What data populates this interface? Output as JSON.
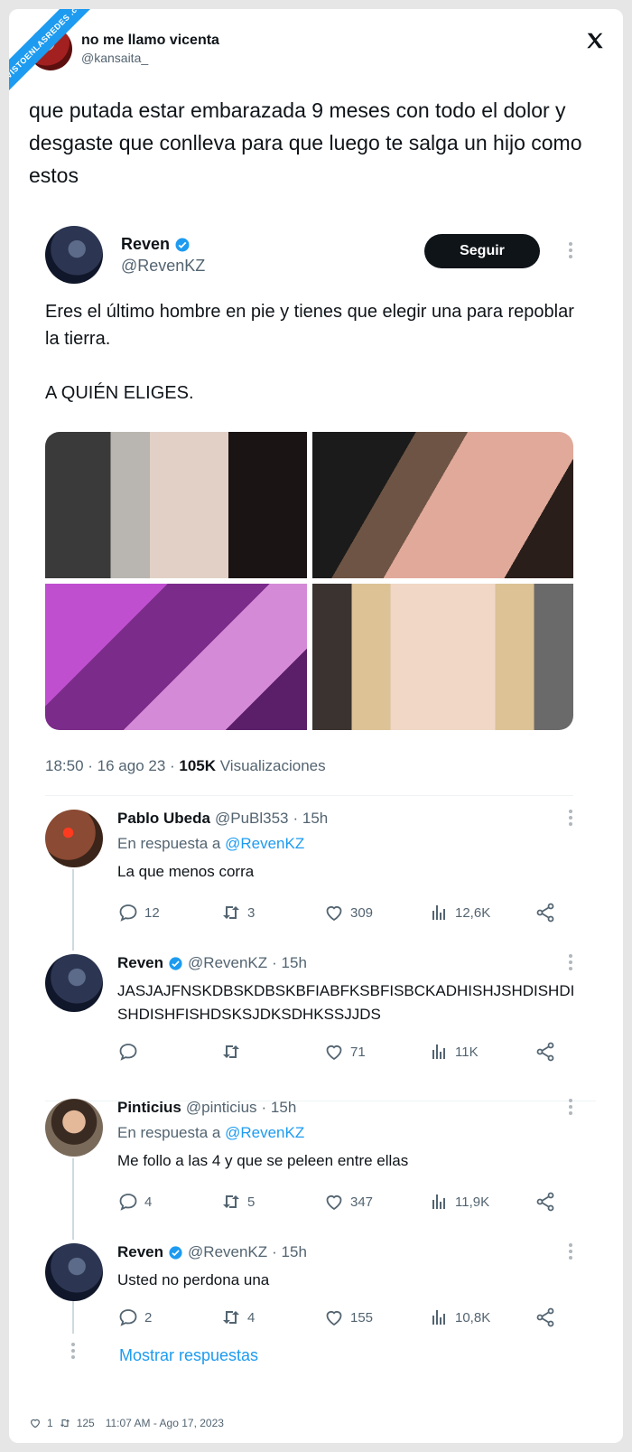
{
  "watermark": "VISTOENLASREDES .com",
  "outer": {
    "name": "no me llamo vicenta",
    "handle": "@kansaita_",
    "text": "que putada estar embarazada 9 meses con todo el dolor y desgaste que conlleva para que luego te salga un hijo como estos"
  },
  "quoted": {
    "name": "Reven",
    "handle": "@RevenKZ",
    "follow_label": "Seguir",
    "text_line1": "Eres el último hombre en pie y tienes que elegir una para repoblar la tierra.",
    "text_line2": "A QUIÉN ELIGES.",
    "time": "18:50 · 16 ago 23 · ",
    "views": "105K",
    "views_label": " Visualizaciones"
  },
  "replies": [
    {
      "name": "Pablo Ubeda",
      "handle": "@PuBl353",
      "time": "· 15h",
      "reply_to_prefix": "En respuesta a ",
      "reply_to": "@RevenKZ",
      "text": "La que menos corra",
      "comments": "12",
      "retweets": "3",
      "likes": "309",
      "views": "12,6K"
    },
    {
      "name": "Reven",
      "handle": "@RevenKZ",
      "time": "· 15h",
      "text": "JASJAJFNSKDBSKDBSKBFIABFKSBFISBCKADHISHJSHDISHDISHDISHFISHDSKSJDKSDHKSSJJDS",
      "comments": "",
      "retweets": "",
      "likes": "71",
      "views": "11K"
    },
    {
      "name": "Pinticius",
      "handle": "@pinticius",
      "time": "· 15h",
      "reply_to_prefix": "En respuesta a ",
      "reply_to": "@RevenKZ",
      "text": "Me follo a las 4 y que se peleen entre ellas",
      "comments": "4",
      "retweets": "5",
      "likes": "347",
      "views": "11,9K"
    },
    {
      "name": "Reven",
      "handle": "@RevenKZ",
      "time": "· 15h",
      "text": "Usted no perdona una",
      "comments": "2",
      "retweets": "4",
      "likes": "155",
      "views": "10,8K"
    }
  ],
  "show_more": "Mostrar respuestas",
  "footer": {
    "likes": "1",
    "retweets": "125",
    "timestamp": "11:07 AM - Ago 17, 2023"
  },
  "colors": {
    "accent": "#1d9bf0",
    "text": "#0f1419",
    "muted": "#536471"
  }
}
